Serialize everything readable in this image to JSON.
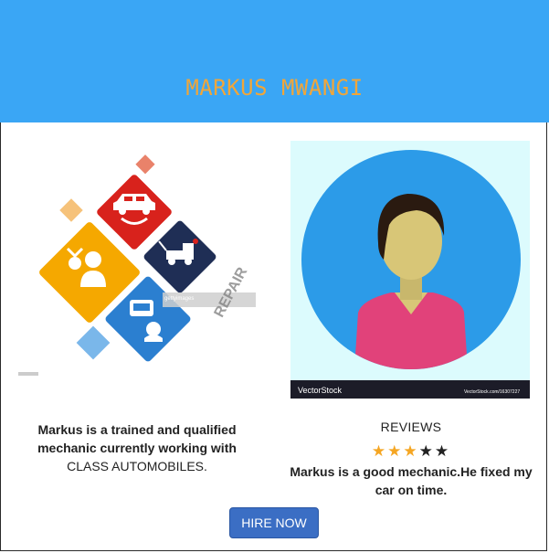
{
  "header": {
    "title": "MARKUS MWANGI"
  },
  "illustration": {
    "overlay_text": "REPAIR",
    "watermark_text": "gettyimages"
  },
  "avatar": {
    "watermark_brand": "VectorStock",
    "watermark_url": "VectorStock.com/16307227"
  },
  "description": {
    "line1": "Markus is a trained and qualified",
    "line2": "mechanic currently working with",
    "line3": "CLASS AUTOMOBILES."
  },
  "reviews": {
    "title": "REVIEWS",
    "rating": 3,
    "max_rating": 5,
    "text_line1": "Markus is a good mechanic.He fixed my",
    "text_line2": "car on time."
  },
  "actions": {
    "hire_label": "HIRE NOW"
  },
  "colors": {
    "header_bg": "#3aa6f5",
    "title": "#f0a63a",
    "button": "#3b6ec4",
    "star_filled": "#f5a623"
  }
}
